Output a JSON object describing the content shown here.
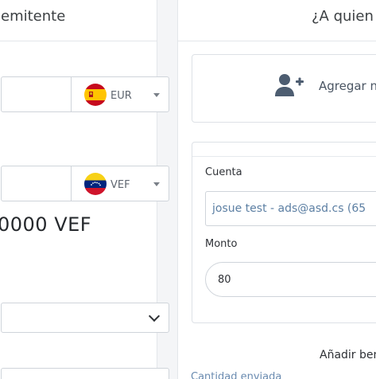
{
  "sender": {
    "title": "Remitente",
    "title_visible": "emitente",
    "currency_from": {
      "code": "EUR",
      "flag": "spain-flag"
    },
    "currency_to": {
      "code": "VEF",
      "flag": "venezuela-flag"
    },
    "converted_amount": "0000 VEF"
  },
  "beneficiary": {
    "title": "¿A quien",
    "add_label": "Agregar n",
    "add_icon": "user-plus-icon",
    "account_label": "Cuenta",
    "account_value": "josue test - ads@asd.cs (65",
    "amount_label": "Monto",
    "amount_value": "80",
    "add_beneficiary": "Añadir ben",
    "amount_sent_label": "Cantidad enviada"
  },
  "colors": {
    "icon": "#4d5d71",
    "link": "#6a8bb0",
    "border": "#cfd4da"
  }
}
